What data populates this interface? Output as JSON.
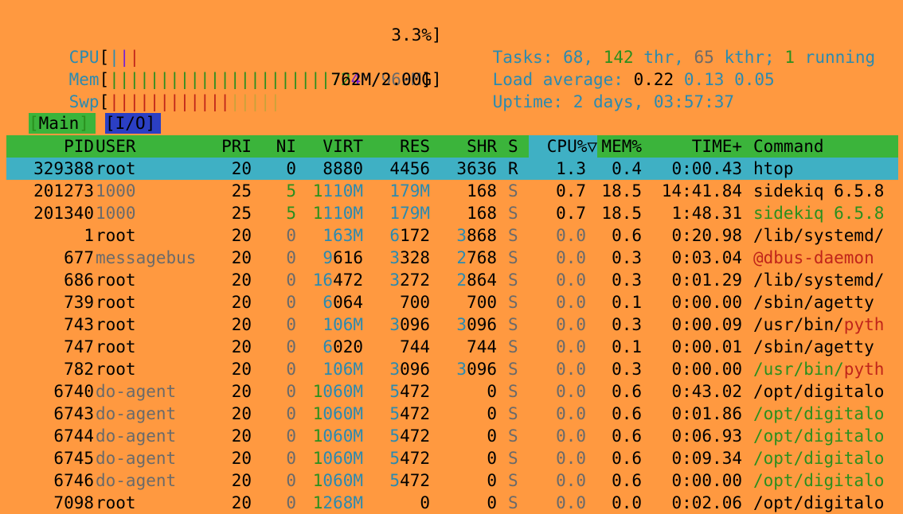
{
  "meters": {
    "cpu": {
      "label": "CPU",
      "bars": "|||",
      "value": "3.3%"
    },
    "mem": {
      "label": "Mem",
      "bars": "||||||||||||||||||||||",
      "value_used_a": "72",
      "value_used_b": "4",
      "value_rest": "M/969M"
    },
    "swp": {
      "label": "Swp",
      "bars_red": "||||||||||||",
      "bars_orange": "|||||",
      "value": "762M/2.00G"
    }
  },
  "summary": {
    "tasks_label": "Tasks:",
    "tasks_count": "68",
    "threads": "142",
    "thr_label": "thr,",
    "kthreads": "65",
    "kthr_label": "kthr;",
    "running": "1",
    "running_label": "running",
    "load_label": "Load average:",
    "load1": "0.22",
    "load5": "0.13",
    "load15": "0.05",
    "uptime_label": "Uptime:",
    "uptime_value": "2 days, 03:57:37"
  },
  "tabs": {
    "main": "Main",
    "io": "I/O"
  },
  "columns": {
    "pid": "PID",
    "user": "USER",
    "pri": "PRI",
    "ni": "NI",
    "virt": "VIRT",
    "res": "RES",
    "shr": "SHR",
    "s": "S",
    "cpu": "CPU%▽",
    "mem": "MEM%",
    "time": "TIME+",
    "command": "Command"
  },
  "processes": [
    {
      "pid": "329388",
      "user": "root",
      "pri": "20",
      "ni": "0",
      "virt": "8880",
      "res": "4456",
      "shr": "3636",
      "s": "R",
      "cpu": "1.3",
      "mem": "0.4",
      "time": "0:00.43",
      "cmd": "htop",
      "selected": true
    },
    {
      "pid": "201273",
      "user": "1000",
      "pri": "25",
      "ni": "5",
      "virt": "1110M",
      "res": "179M",
      "shr": "168",
      "s": "S",
      "cpu": "0.7",
      "mem": "18.5",
      "time": "14:41.84",
      "cmd": "sidekiq 6.5.8"
    },
    {
      "pid": "201340",
      "user": "1000",
      "pri": "25",
      "ni": "5",
      "virt": "1110M",
      "res": "179M",
      "shr": "168",
      "s": "S",
      "cpu": "0.7",
      "mem": "18.5",
      "time": "1:48.31",
      "cmd": "sidekiq 6.5.8"
    },
    {
      "pid": "1",
      "user": "root",
      "pri": "20",
      "ni": "0",
      "virt": "163M",
      "res": "6172",
      "shr": "3868",
      "s": "S",
      "cpu": "0.0",
      "mem": "0.6",
      "time": "0:20.98",
      "cmd": "/lib/systemd/"
    },
    {
      "pid": "677",
      "user": "messagebus",
      "pri": "20",
      "ni": "0",
      "virt": "9616",
      "res": "3328",
      "shr": "2768",
      "s": "S",
      "cpu": "0.0",
      "mem": "0.3",
      "time": "0:03.04",
      "cmd": "@dbus-daemon"
    },
    {
      "pid": "686",
      "user": "root",
      "pri": "20",
      "ni": "0",
      "virt": "16472",
      "res": "3272",
      "shr": "2864",
      "s": "S",
      "cpu": "0.0",
      "mem": "0.3",
      "time": "0:01.29",
      "cmd": "/lib/systemd/"
    },
    {
      "pid": "739",
      "user": "root",
      "pri": "20",
      "ni": "0",
      "virt": "6064",
      "res": "700",
      "shr": "700",
      "s": "S",
      "cpu": "0.0",
      "mem": "0.1",
      "time": "0:00.00",
      "cmd": "/sbin/agetty"
    },
    {
      "pid": "743",
      "user": "root",
      "pri": "20",
      "ni": "0",
      "virt": "106M",
      "res": "3096",
      "shr": "3096",
      "s": "S",
      "cpu": "0.0",
      "mem": "0.3",
      "time": "0:00.09",
      "cmd": "/usr/bin/pyth"
    },
    {
      "pid": "747",
      "user": "root",
      "pri": "20",
      "ni": "0",
      "virt": "6020",
      "res": "744",
      "shr": "744",
      "s": "S",
      "cpu": "0.0",
      "mem": "0.1",
      "time": "0:00.01",
      "cmd": "/sbin/agetty"
    },
    {
      "pid": "782",
      "user": "root",
      "pri": "20",
      "ni": "0",
      "virt": "106M",
      "res": "3096",
      "shr": "3096",
      "s": "S",
      "cpu": "0.0",
      "mem": "0.3",
      "time": "0:00.00",
      "cmd": "/usr/bin/pyth"
    },
    {
      "pid": "6740",
      "user": "do-agent",
      "pri": "20",
      "ni": "0",
      "virt": "1060M",
      "res": "5472",
      "shr": "0",
      "s": "S",
      "cpu": "0.0",
      "mem": "0.6",
      "time": "0:43.02",
      "cmd": "/opt/digitalo"
    },
    {
      "pid": "6743",
      "user": "do-agent",
      "pri": "20",
      "ni": "0",
      "virt": "1060M",
      "res": "5472",
      "shr": "0",
      "s": "S",
      "cpu": "0.0",
      "mem": "0.6",
      "time": "0:01.86",
      "cmd": "/opt/digitalo"
    },
    {
      "pid": "6744",
      "user": "do-agent",
      "pri": "20",
      "ni": "0",
      "virt": "1060M",
      "res": "5472",
      "shr": "0",
      "s": "S",
      "cpu": "0.0",
      "mem": "0.6",
      "time": "0:06.93",
      "cmd": "/opt/digitalo"
    },
    {
      "pid": "6745",
      "user": "do-agent",
      "pri": "20",
      "ni": "0",
      "virt": "1060M",
      "res": "5472",
      "shr": "0",
      "s": "S",
      "cpu": "0.0",
      "mem": "0.6",
      "time": "0:09.34",
      "cmd": "/opt/digitalo"
    },
    {
      "pid": "6746",
      "user": "do-agent",
      "pri": "20",
      "ni": "0",
      "virt": "1060M",
      "res": "5472",
      "shr": "0",
      "s": "S",
      "cpu": "0.0",
      "mem": "0.6",
      "time": "0:00.00",
      "cmd": "/opt/digitalo"
    },
    {
      "pid": "7098",
      "user": "root",
      "pri": "20",
      "ni": "0",
      "virt": "1268M",
      "res": "0",
      "shr": "0",
      "s": "S",
      "cpu": "0.0",
      "mem": "0.0",
      "time": "0:02.06",
      "cmd": "/opt/digitalo"
    }
  ],
  "colors": {
    "background": "#ff9940",
    "header_green": "#3bb43b",
    "selection_cyan": "#3fb0c4",
    "io_tab_blue": "#2b3fc4"
  }
}
